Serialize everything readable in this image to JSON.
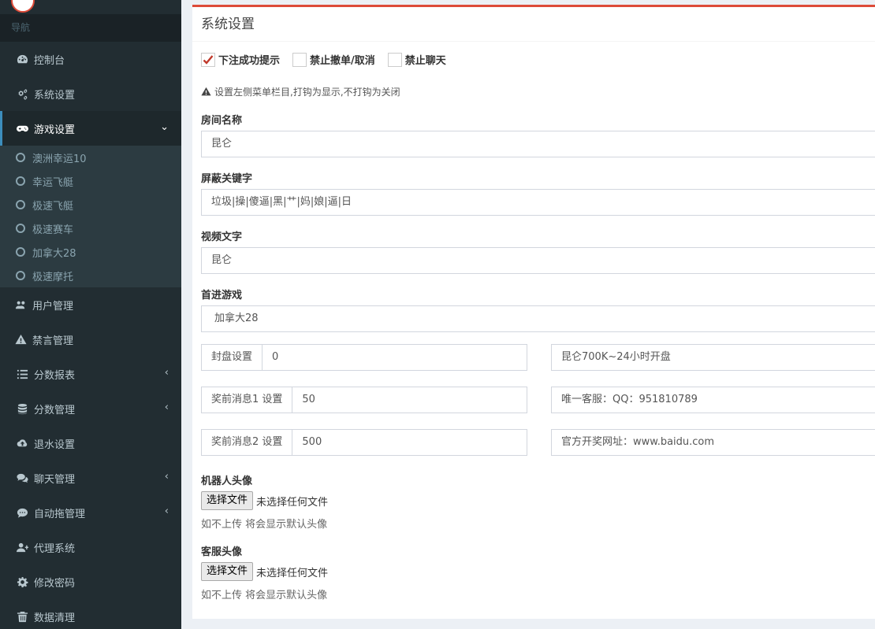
{
  "sidebar": {
    "nav_header": "导航",
    "items": [
      {
        "label": "控制台",
        "icon": "dashboard-icon"
      },
      {
        "label": "系统设置",
        "icon": "cogs-icon"
      },
      {
        "label": "游戏设置",
        "icon": "gamepad-icon",
        "arrow": "⌄",
        "active": true
      },
      {
        "label": "用户管理",
        "icon": "users-icon"
      },
      {
        "label": "禁言管理",
        "icon": "warning-icon"
      },
      {
        "label": "分数报表",
        "icon": "list-icon",
        "arrow": "‹"
      },
      {
        "label": "分数管理",
        "icon": "database-icon",
        "arrow": "‹"
      },
      {
        "label": "退水设置",
        "icon": "cloud-upload-icon"
      },
      {
        "label": "聊天管理",
        "icon": "comments-icon",
        "arrow": "‹"
      },
      {
        "label": "自动拖管理",
        "icon": "commenting-icon",
        "arrow": "‹"
      },
      {
        "label": "代理系统",
        "icon": "user-plus-icon"
      },
      {
        "label": "修改密码",
        "icon": "gear-icon"
      },
      {
        "label": "数据清理",
        "icon": "trash-icon"
      }
    ],
    "submenu": [
      "澳洲幸运10",
      "幸运飞艇",
      "极速飞艇",
      "极速赛车",
      "加拿大28",
      "极速摩托"
    ]
  },
  "panel": {
    "title": "系统设置",
    "checkboxes": [
      {
        "label": "下注成功提示",
        "checked": true
      },
      {
        "label": "禁止撤单/取消",
        "checked": false
      },
      {
        "label": "禁止聊天",
        "checked": false
      }
    ],
    "hint": "设置左侧菜单栏目,打钩为显示,不打钩为关闭",
    "room_name_label": "房间名称",
    "room_name_value": "昆仑",
    "blocked_keywords_label": "屏蔽关键字",
    "blocked_keywords_value": "垃圾|操|傻逼|黑|艹|妈|娘|逼|日",
    "video_text_label": "视频文字",
    "video_text_value": "昆仑",
    "first_game_label": "首进游戏",
    "first_game_value": "加拿大28",
    "close_setting_addon": "封盘设置",
    "close_setting_value": "0",
    "prize_msg1_addon": "奖前消息1 设置",
    "prize_msg1_value": "50",
    "prize_msg2_addon": "奖前消息2 设置",
    "prize_msg2_value": "500",
    "right_field1_value": "昆仑700K~24小时开盘",
    "right_field2_value": "唯一客服：QQ：951810789",
    "right_field3_value": "官方开奖网址：www.baidu.com",
    "robot_avatar_label": "机器人头像",
    "service_avatar_label": "客服头像",
    "file_button_label": "选择文件",
    "file_status": "未选择任何文件",
    "file_help": "如不上传 将会显示默认头像"
  },
  "colors": {
    "sidebar_bg": "#222d32",
    "accent": "#3c8dbc",
    "panel_top_border": "#dd4b39",
    "check_color": "#c0392b"
  }
}
